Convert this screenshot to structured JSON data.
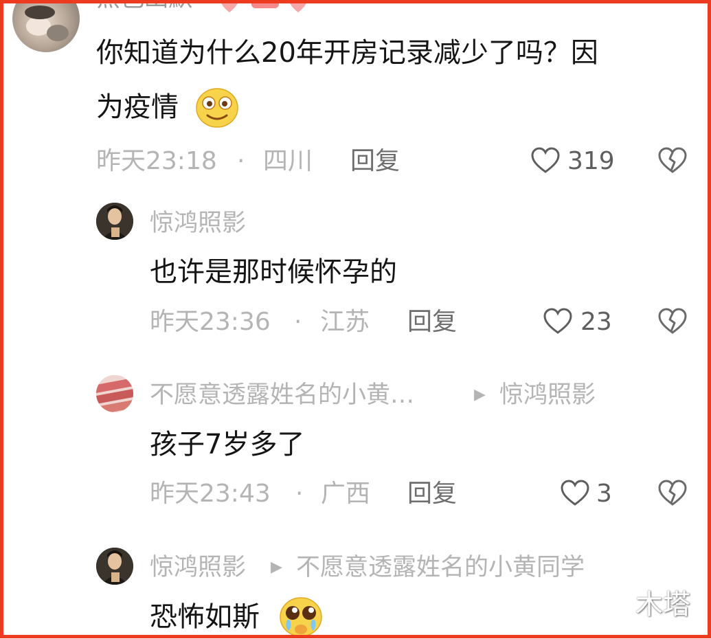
{
  "comment": {
    "username": "黑色幽默",
    "text_line1": "你知道为什么20年开房记录减少了吗？因",
    "text_line2": "为疫情",
    "time": "昨天23:18",
    "separator": "·",
    "location": "四川",
    "reply_label": "回复",
    "likes": "319"
  },
  "replies": [
    {
      "username": "惊鸿照影",
      "text": "也许是那时候怀孕的",
      "time": "昨天23:36",
      "separator": "·",
      "location": "江苏",
      "reply_label": "回复",
      "likes": "23"
    },
    {
      "username": "不愿意透露姓名的小黄…",
      "reply_to": "惊鸿照影",
      "text": "孩子7岁多了",
      "time": "昨天23:43",
      "separator": "·",
      "location": "广西",
      "reply_label": "回复",
      "likes": "3"
    },
    {
      "username": "惊鸿照影",
      "reply_to": "不愿意透露姓名的小黄同学",
      "text": "恐怖如斯"
    }
  ],
  "watermark": "木塔",
  "icons": {
    "like": "heart-outline-icon",
    "dislike": "broken-heart-icon",
    "reply_arrow": "play-triangle-icon"
  },
  "colors": {
    "frame_border": "#ec3b1f",
    "muted_text": "#b4b4b4",
    "body_text": "#151515"
  }
}
